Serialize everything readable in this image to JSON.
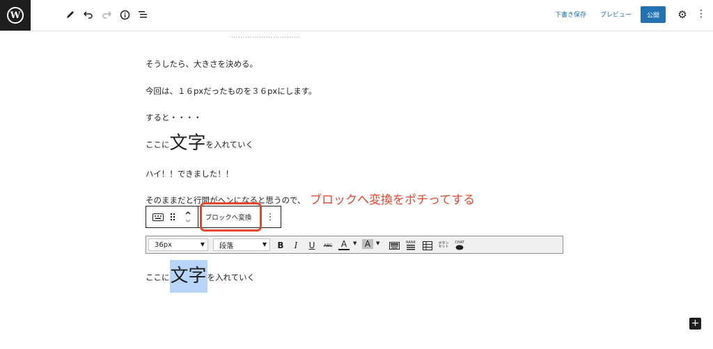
{
  "topbar": {
    "logo": "W",
    "add": "+",
    "draft_save": "下書き保存",
    "preview": "プレビュー",
    "publish": "公開",
    "icons": [
      "pencil-icon",
      "undo-icon",
      "redo-icon",
      "info-icon",
      "list-view-icon",
      "gear-icon",
      "more-vertical-icon"
    ]
  },
  "editor": {
    "cut_off_text": "…………………………",
    "paragraphs": [
      "そうしたら、大きさを決める。",
      "今回は、１６pxだったものを３６pxにします。",
      "すると・・・・"
    ],
    "example1": {
      "prefix": "ここに",
      "big": "文字",
      "suffix": "を入れていく"
    },
    "done": "ハイ！！できました！！",
    "last_line": "そのままだと行間がヘンになると思うので、",
    "example2": {
      "prefix": "ここに",
      "big": "文字",
      "suffix": "を入れていく"
    }
  },
  "annotation": "ブロックへ変換をポチってする",
  "block_toolbar": {
    "convert_label": "ブロックへ変換"
  },
  "format_toolbar": {
    "font_size": "36px",
    "paragraph": "段落",
    "labels": {
      "bold": "B",
      "italic": "I",
      "underline": "U",
      "strike": "ABC",
      "text_color": "A",
      "bg_color": "A",
      "rank": "RANK",
      "button": "ボタン セット",
      "chat": "CHAT"
    }
  },
  "colors": {
    "accent": "#2271b1",
    "annotation": "#e8452c",
    "selection": "#b8d5f7"
  }
}
